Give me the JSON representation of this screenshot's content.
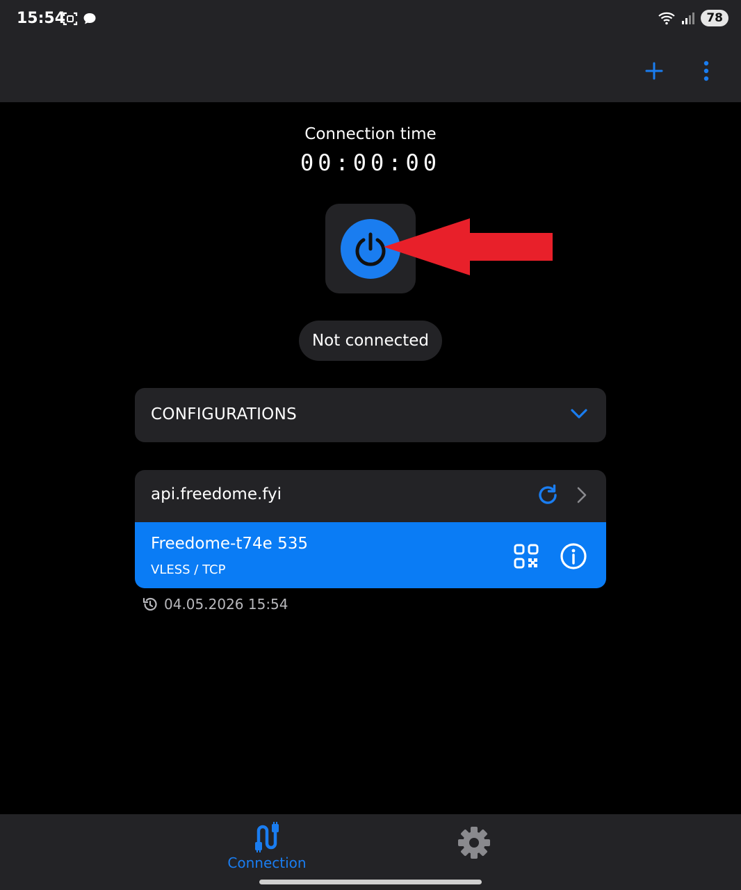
{
  "status_bar": {
    "time": "15:54",
    "battery": "78",
    "icons": [
      "screenshot-icon",
      "chat-bubble-icon",
      "wifi-icon",
      "signal-icon"
    ]
  },
  "app_bar": {
    "actions": [
      "add-icon",
      "more-vert-icon"
    ]
  },
  "connection": {
    "time_label": "Connection time",
    "timer": "00:00:00",
    "status": "Not connected"
  },
  "configurations": {
    "label": "CONFIGURATIONS"
  },
  "subscription": {
    "host": "api.freedome.fyi",
    "server_name": "Freedome-t74e      535",
    "protocol": "VLESS / TCP",
    "last_update": "04.05.2026 15:54"
  },
  "bottom_nav": {
    "items": [
      {
        "label": "Connection",
        "icon": "cable-icon",
        "active": true
      },
      {
        "label": "",
        "icon": "gear-icon",
        "active": false
      }
    ]
  },
  "colors": {
    "accent": "#1a7df0",
    "surface": "#232326",
    "background": "#000000",
    "arrow": "#e8202a"
  }
}
